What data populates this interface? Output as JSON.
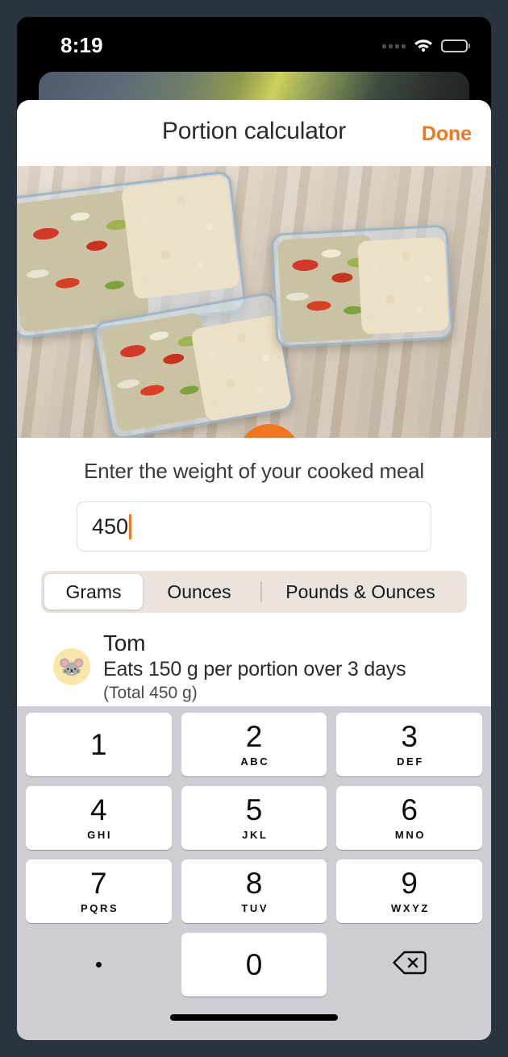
{
  "status_bar": {
    "time": "8:19",
    "signal_icon": "signal-dots-icon",
    "wifi_icon": "wifi-icon",
    "battery_icon": "battery-full-icon"
  },
  "sheet": {
    "title": "Portion calculator",
    "done_label": "Done"
  },
  "video": {
    "play_icon": "play-icon",
    "description": "Glass meal prep containers with rice and vegetables on a wooden table with a green kitchen scale"
  },
  "form": {
    "weight_label": "Enter the weight of your cooked meal",
    "weight_value": "450",
    "weight_placeholder": "0",
    "units": [
      {
        "label": "Grams",
        "selected": true
      },
      {
        "label": "Ounces",
        "selected": false
      },
      {
        "label": "Pounds & Ounces",
        "selected": false
      }
    ]
  },
  "person": {
    "avatar_emoji": "🐭",
    "avatar_icon": "mouse-face-avatar",
    "name": "Tom",
    "detail": "Eats 150 g per portion over 3 days",
    "total": "(Total 450 g)"
  },
  "keypad": {
    "rows": [
      [
        {
          "digit": "1",
          "letters": ""
        },
        {
          "digit": "2",
          "letters": "ABC"
        },
        {
          "digit": "3",
          "letters": "DEF"
        }
      ],
      [
        {
          "digit": "4",
          "letters": "GHI"
        },
        {
          "digit": "5",
          "letters": "JKL"
        },
        {
          "digit": "6",
          "letters": "MNO"
        }
      ],
      [
        {
          "digit": "7",
          "letters": "PQRS"
        },
        {
          "digit": "8",
          "letters": "TUV"
        },
        {
          "digit": "9",
          "letters": "WXYZ"
        }
      ]
    ],
    "decimal_label": ".",
    "zero_label": "0",
    "delete_icon": "delete-backspace-icon"
  },
  "colors": {
    "accent_orange": "#f4761c",
    "done_orange": "#ef7622",
    "keypad_background": "#ccced4",
    "segment_background": "#eae3de",
    "avatar_background": "#fae6a8",
    "device_frame": "#2a3440"
  }
}
